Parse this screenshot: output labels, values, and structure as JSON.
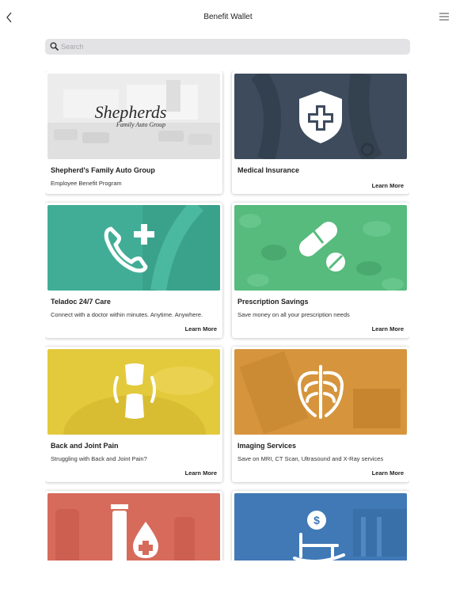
{
  "header": {
    "title": "Benefit Wallet",
    "back_icon": "chevron-left-icon",
    "menu_icon": "hamburger-menu-icon"
  },
  "search": {
    "placeholder": "Search",
    "value": "",
    "icon": "search-icon"
  },
  "cards": [
    {
      "title": "Shepherd's Family Auto Group",
      "description": "Employee Benefit Program",
      "link": "",
      "logo_text": "Shepherds",
      "logo_subtext": "Family Auto Group",
      "image": "dealership-photo",
      "icon": "logo"
    },
    {
      "title": "Medical Insurance",
      "description": "",
      "link": "Learn More",
      "image": "medical-shield",
      "icon": "shield-cross-icon",
      "color": "#3b4a5c"
    },
    {
      "title": "Teladoc 24/7 Care",
      "description": "Connect with a doctor within minutes. Anytime. Anywhere.",
      "link": "Learn More",
      "image": "teladoc",
      "icon": "phone-plus-icon",
      "color": "#3eae96"
    },
    {
      "title": "Prescription Savings",
      "description": "Save money on all your prescription needs",
      "link": "Learn More",
      "image": "pills",
      "icon": "pill-icon",
      "color": "#4fbb7a"
    },
    {
      "title": "Back and Joint Pain",
      "description": "Struggling with Back and Joint Pain?",
      "link": "Learn More",
      "image": "joint",
      "icon": "joint-icon",
      "color": "#e2c83a"
    },
    {
      "title": "Imaging Services",
      "description": "Save on MRI, CT Scan, Ultrasound and X-Ray services",
      "link": "Learn More",
      "image": "imaging",
      "icon": "ribcage-icon",
      "color": "#d5943c"
    },
    {
      "title": "",
      "description": "",
      "link": "",
      "image": "lab",
      "icon": "blood-test-icon",
      "color": "#d66a5a"
    },
    {
      "title": "",
      "description": "",
      "link": "",
      "image": "retirement",
      "icon": "rocking-chair-dollar-icon",
      "color": "#3f78b5"
    }
  ]
}
